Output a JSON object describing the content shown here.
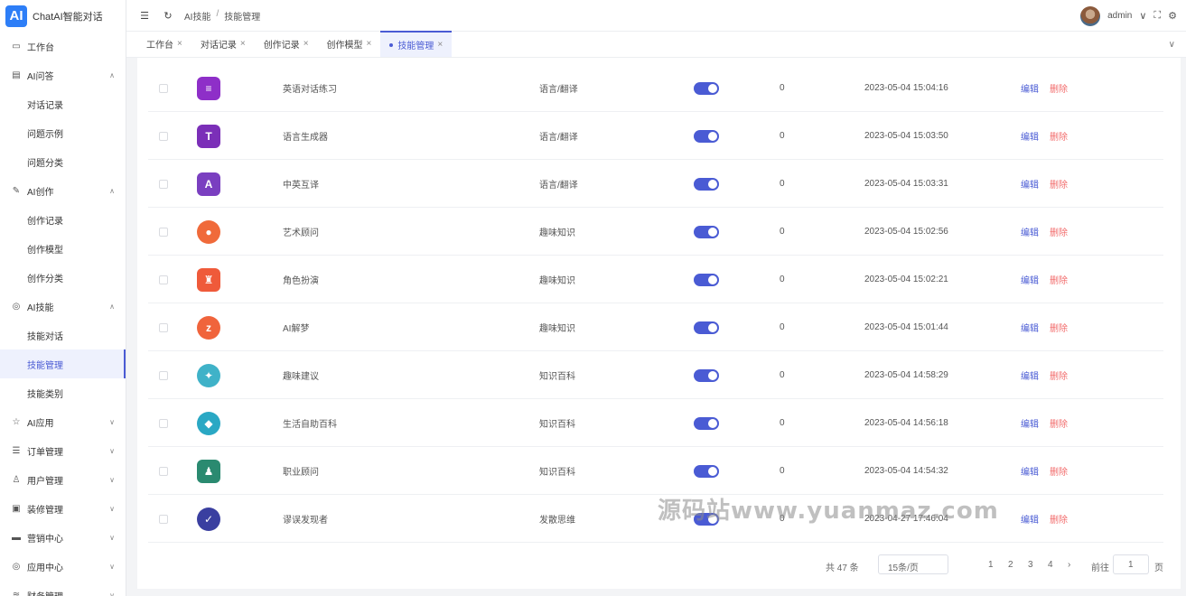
{
  "app": {
    "logo_mark": "AI",
    "title": "ChatAI智能对话"
  },
  "sidebar": {
    "items": [
      {
        "label": "工作台",
        "icon": "monitor-icon",
        "glyph": "▭",
        "chevron": ""
      },
      {
        "label": "AI问答",
        "icon": "chat-icon",
        "glyph": "▤",
        "chevron": "∧"
      },
      {
        "label": "对话记录",
        "sub": true
      },
      {
        "label": "问题示例",
        "sub": true
      },
      {
        "label": "问题分类",
        "sub": true
      },
      {
        "label": "AI创作",
        "icon": "pen-icon",
        "glyph": "✎",
        "chevron": "∧"
      },
      {
        "label": "创作记录",
        "sub": true
      },
      {
        "label": "创作模型",
        "sub": true
      },
      {
        "label": "创作分类",
        "sub": true
      },
      {
        "label": "AI技能",
        "icon": "target-icon",
        "glyph": "◎",
        "chevron": "∧"
      },
      {
        "label": "技能对话",
        "sub": true
      },
      {
        "label": "技能管理",
        "sub": true,
        "active": true
      },
      {
        "label": "技能类别",
        "sub": true
      },
      {
        "label": "AI应用",
        "icon": "star-icon",
        "glyph": "☆",
        "chevron": "∨"
      },
      {
        "label": "订单管理",
        "icon": "database-icon",
        "glyph": "☰",
        "chevron": "∨"
      },
      {
        "label": "用户管理",
        "icon": "user-icon",
        "glyph": "♙",
        "chevron": "∨"
      },
      {
        "label": "装修管理",
        "icon": "brush-icon",
        "glyph": "▣",
        "chevron": "∨"
      },
      {
        "label": "营销中心",
        "icon": "briefcase-icon",
        "glyph": "▬",
        "chevron": "∨"
      },
      {
        "label": "应用中心",
        "icon": "apps-icon",
        "glyph": "◎",
        "chevron": "∨"
      },
      {
        "label": "财务管理",
        "icon": "finance-icon",
        "glyph": "≋",
        "chevron": "∨"
      }
    ]
  },
  "header": {
    "breadcrumb": [
      "AI技能",
      "技能管理"
    ],
    "breadcrumb_sep": "/",
    "username": "admin",
    "user_chevron": "∨"
  },
  "tabs": [
    {
      "label": "工作台"
    },
    {
      "label": "对话记录"
    },
    {
      "label": "创作记录"
    },
    {
      "label": "创作模型"
    },
    {
      "label": "技能管理",
      "active": true
    }
  ],
  "table": {
    "rows": [
      {
        "name": "英语对话练习",
        "category": "语言/翻译",
        "count": "0",
        "time": "2023-05-04 15:04:16",
        "icon": "chat-bubble-icon",
        "icon_color": "#8e2fc8",
        "glyph": "≡",
        "round": false
      },
      {
        "name": "语言生成器",
        "category": "语言/翻译",
        "count": "0",
        "time": "2023-05-04 15:03:50",
        "icon": "text-generator-icon",
        "icon_color": "#7b2fb8",
        "glyph": "T",
        "round": false
      },
      {
        "name": "中英互译",
        "category": "语言/翻译",
        "count": "0",
        "time": "2023-05-04 15:03:31",
        "icon": "translate-icon",
        "icon_color": "#7a3fc0",
        "glyph": "A",
        "round": false
      },
      {
        "name": "艺术顾问",
        "category": "趣味知识",
        "count": "0",
        "time": "2023-05-04 15:02:56",
        "icon": "palette-icon",
        "icon_color": "#f06a3a",
        "glyph": "●",
        "round": true
      },
      {
        "name": "角色扮演",
        "category": "趣味知识",
        "count": "0",
        "time": "2023-05-04 15:02:21",
        "icon": "spy-icon",
        "icon_color": "#ef5a3a",
        "glyph": "♜",
        "round": false
      },
      {
        "name": "AI解梦",
        "category": "趣味知识",
        "count": "0",
        "time": "2023-05-04 15:01:44",
        "icon": "moon-icon",
        "icon_color": "#f0643c",
        "glyph": "z",
        "round": true
      },
      {
        "name": "趣味建议",
        "category": "知识百科",
        "count": "0",
        "time": "2023-05-04 14:58:29",
        "icon": "smile-icon",
        "icon_color": "#3fb2c8",
        "glyph": "✦",
        "round": true
      },
      {
        "name": "生活自助百科",
        "category": "知识百科",
        "count": "0",
        "time": "2023-05-04 14:56:18",
        "icon": "water-drop-icon",
        "icon_color": "#2aa8c4",
        "glyph": "◆",
        "round": true
      },
      {
        "name": "职业顾问",
        "category": "知识百科",
        "count": "0",
        "time": "2023-05-04 14:54:32",
        "icon": "businessman-icon",
        "icon_color": "#2a8a70",
        "glyph": "♟",
        "round": false
      },
      {
        "name": "谬误发现者",
        "category": "发散思维",
        "count": "0",
        "time": "2023-04-27 17:46:04",
        "icon": "lightbulb-icon",
        "icon_color": "#3a3fa0",
        "glyph": "✓",
        "round": true
      }
    ],
    "edit_label": "编辑",
    "delete_label": "删除",
    "status_on": true
  },
  "pagination": {
    "total": "共 47 条",
    "page_size": "15条/页",
    "pages": [
      "1",
      "2",
      "3",
      "4"
    ],
    "next": "›",
    "goto": "前往",
    "goto_value": "1",
    "goto_suffix": "页"
  },
  "watermark": "源码站www.yuanmaz.com"
}
